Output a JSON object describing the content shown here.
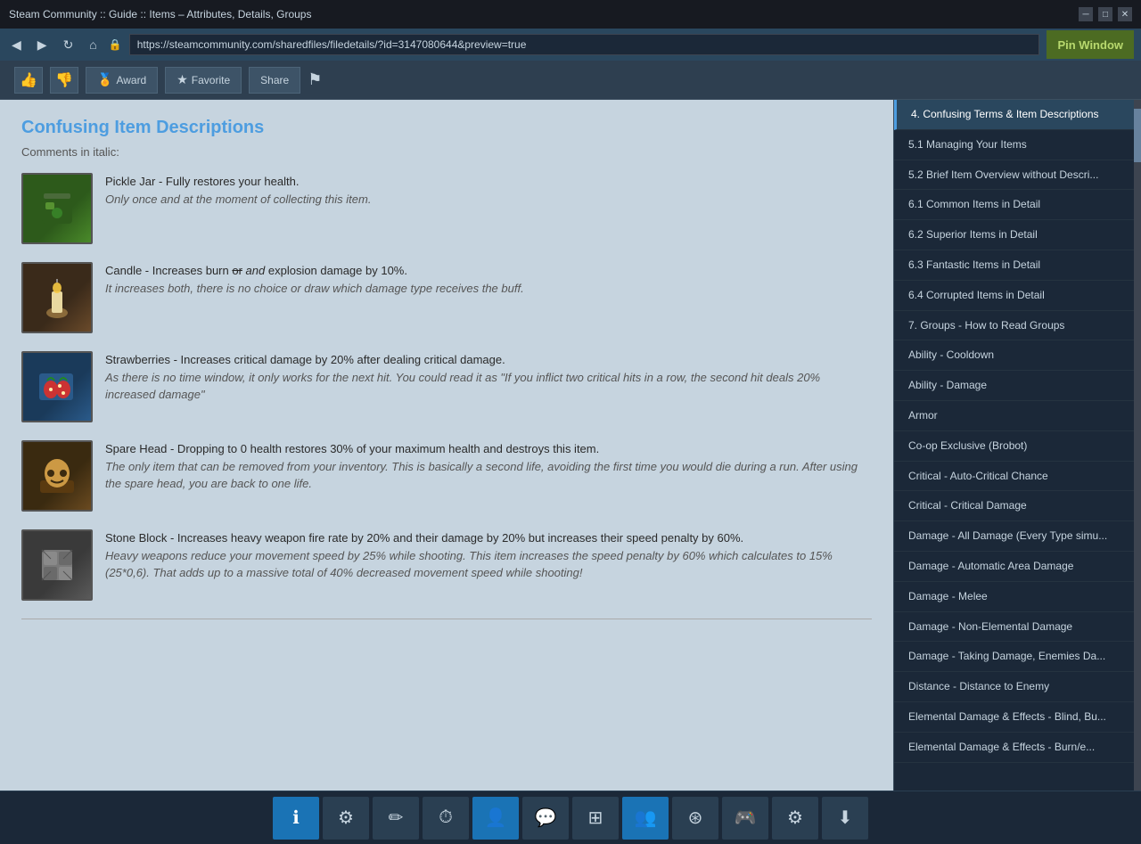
{
  "window": {
    "title": "Steam Community :: Guide :: Items – Attributes, Details, Groups",
    "url": "https://steamcommunity.com/sharedfiles/filedetails/?id=3147080644&preview=true"
  },
  "pin_window_label": "Pin Window",
  "actions": {
    "thumbup": "👍",
    "thumbdown": "👎",
    "award_label": "Award",
    "favorite_label": "Favorite",
    "share_label": "Share",
    "flag": "⚑"
  },
  "content": {
    "title": "Confusing Item Descriptions",
    "subtitle": "Comments in italic:",
    "items": [
      {
        "id": "pickle-jar",
        "icon": "🫙",
        "name_text": "Pickle Jar - Fully restores your health.",
        "italic_text": "Only once and at the moment of collecting this item."
      },
      {
        "id": "candle",
        "icon": "🕯️",
        "name_text": "Candle - Increases burn or and explosion damage by 10%.",
        "italic_text": "It increases both, there is no choice or draw which damage type receives the buff."
      },
      {
        "id": "strawberries",
        "icon": "🍓",
        "name_text": "Strawberries - Increases critical damage by 20% after dealing critical damage.",
        "italic_text": "As there is no time window, it only works for the next hit. You could read it as \"If you inflict two critical hits in a row, the second hit deals 20% increased damage\""
      },
      {
        "id": "spare-head",
        "icon": "💀",
        "name_text": "Spare Head - Dropping to 0 health restores 30% of your maximum health and destroys this item.",
        "italic_text": "The only item that can be removed from your inventory. This is basically a second life, avoiding the first time you would die during a run. After using the spare head, you are back to one life."
      },
      {
        "id": "stone-block",
        "icon": "🪨",
        "name_text": "Stone Block - Increases heavy weapon fire rate by 20% and their damage by 20% but increases their speed penalty by 60%.",
        "italic_text": "Heavy weapons reduce your movement speed by 25% while shooting. This item increases the speed penalty by 60% which calculates to 15% (25*0,6). That adds up to a massive total of 40% decreased movement speed while shooting!"
      }
    ]
  },
  "sidebar": {
    "items": [
      {
        "id": "confusing-terms",
        "label": "4. Confusing Terms & Item Descriptions",
        "active": true
      },
      {
        "id": "managing-items",
        "label": "5.1 Managing Your Items",
        "active": false
      },
      {
        "id": "brief-overview",
        "label": "5.2 Brief Item Overview without Descri...",
        "active": false
      },
      {
        "id": "common-items",
        "label": "6.1 Common Items in Detail",
        "active": false
      },
      {
        "id": "superior-items",
        "label": "6.2 Superior Items in Detail",
        "active": false
      },
      {
        "id": "fantastic-items",
        "label": "6.3 Fantastic Items in Detail",
        "active": false
      },
      {
        "id": "corrupted-items",
        "label": "6.4 Corrupted Items in Detail",
        "active": false
      },
      {
        "id": "groups",
        "label": "7. Groups - How to Read Groups",
        "active": false
      },
      {
        "id": "ability-cooldown",
        "label": "Ability - Cooldown",
        "active": false
      },
      {
        "id": "ability-damage",
        "label": "Ability - Damage",
        "active": false
      },
      {
        "id": "armor",
        "label": "Armor",
        "active": false
      },
      {
        "id": "coop-exclusive",
        "label": "Co-op Exclusive (Brobot)",
        "active": false
      },
      {
        "id": "critical-auto",
        "label": "Critical - Auto-Critical Chance",
        "active": false
      },
      {
        "id": "critical-damage",
        "label": "Critical - Critical Damage",
        "active": false
      },
      {
        "id": "damage-all",
        "label": "Damage - All Damage (Every Type simu...",
        "active": false
      },
      {
        "id": "damage-auto",
        "label": "Damage - Automatic Area Damage",
        "active": false
      },
      {
        "id": "damage-melee",
        "label": "Damage - Melee",
        "active": false
      },
      {
        "id": "damage-non-elemental",
        "label": "Damage - Non-Elemental Damage",
        "active": false
      },
      {
        "id": "damage-taking",
        "label": "Damage - Taking Damage, Enemies Da...",
        "active": false
      },
      {
        "id": "distance",
        "label": "Distance - Distance to Enemy",
        "active": false
      },
      {
        "id": "elemental-blind",
        "label": "Elemental Damage & Effects - Blind, Bu...",
        "active": false
      },
      {
        "id": "elemental-burn",
        "label": "Elemental Damage & Effects - Burn/e...",
        "active": false
      }
    ]
  },
  "taskbar": {
    "buttons": [
      {
        "id": "info",
        "icon": "ℹ",
        "active": false,
        "blue": true
      },
      {
        "id": "settings",
        "icon": "⚙",
        "active": false,
        "blue": false
      },
      {
        "id": "edit",
        "icon": "✏",
        "active": false,
        "blue": false
      },
      {
        "id": "clock",
        "icon": "⏱",
        "active": false,
        "blue": false
      },
      {
        "id": "person",
        "icon": "👤",
        "active": true,
        "blue": true
      },
      {
        "id": "chat",
        "icon": "💬",
        "active": false,
        "blue": false
      },
      {
        "id": "screenshot",
        "icon": "⊞",
        "active": false,
        "blue": false
      },
      {
        "id": "friends",
        "icon": "👥",
        "active": true,
        "blue": true
      },
      {
        "id": "store",
        "icon": "⊛",
        "active": false,
        "blue": false
      },
      {
        "id": "controller",
        "icon": "🎮",
        "active": false,
        "blue": false
      },
      {
        "id": "settings2",
        "icon": "⚙",
        "active": false,
        "blue": false
      },
      {
        "id": "download",
        "icon": "⬇",
        "active": false,
        "blue": false
      }
    ]
  }
}
